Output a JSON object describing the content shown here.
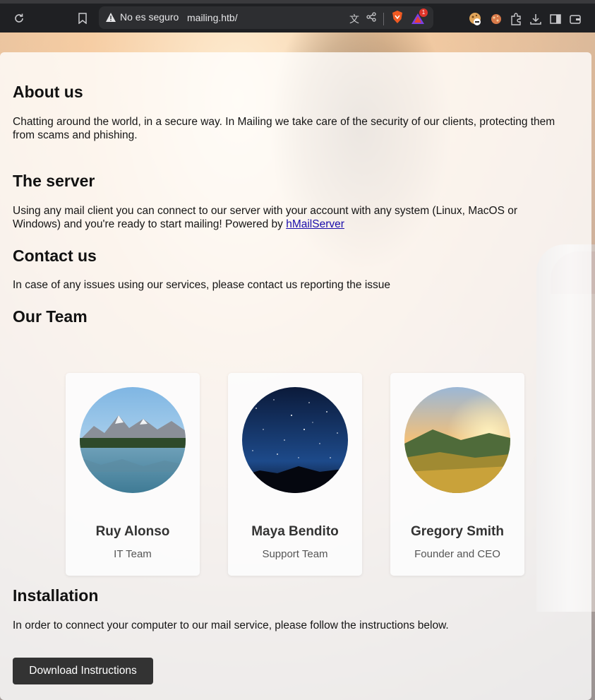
{
  "browser": {
    "security_label": "No es seguro",
    "url": "mailing.htb/",
    "shield_badge_count": "1"
  },
  "page": {
    "about": {
      "heading": "About us",
      "text": "Chatting around the world, in a secure way. In Mailing we take care of the security of our clients, protecting them from scams and phishing."
    },
    "server": {
      "heading": "The server",
      "text_before_link": "Using any mail client you can connect to our server with your account with any system (Linux, MacOS or Windows) and you're ready to start mailing! Powered by ",
      "link_text": "hMailServer"
    },
    "contact": {
      "heading": "Contact us",
      "text": "In case of any issues using our services, please contact us reporting the issue"
    },
    "team": {
      "heading": "Our Team",
      "members": [
        {
          "name": "Ruy Alonso",
          "role": "IT Team"
        },
        {
          "name": "Maya Bendito",
          "role": "Support Team"
        },
        {
          "name": "Gregory Smith",
          "role": "Founder and CEO"
        }
      ]
    },
    "installation": {
      "heading": "Installation",
      "text": "In order to connect your computer to our mail service, please follow the instructions below.",
      "button_label": "Download Instructions"
    }
  }
}
